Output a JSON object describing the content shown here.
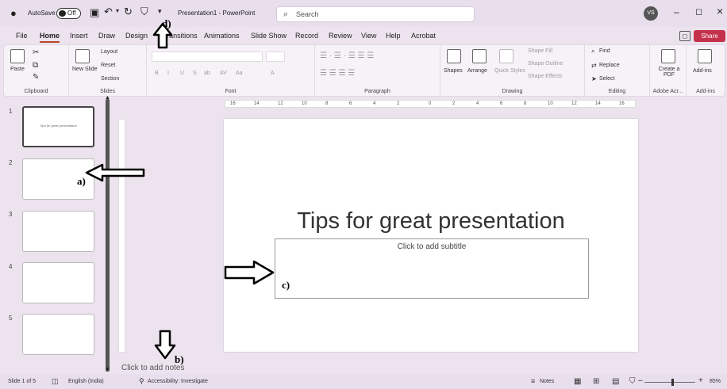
{
  "titlebar": {
    "autosave_label": "AutoSave",
    "autosave_state": "Off",
    "doc_title": "Presentation1 - PowerPoint",
    "search_placeholder": "Search",
    "avatar_initials": "VS",
    "minimize_glyph": "–",
    "restore_glyph": "◻",
    "close_glyph": "×"
  },
  "tabs": [
    "File",
    "Home",
    "Insert",
    "Draw",
    "Design",
    "Transitions",
    "Animations",
    "Slide Show",
    "Record",
    "Review",
    "View",
    "Help",
    "Acrobat"
  ],
  "active_tab": "Home",
  "share_label": "Share",
  "ribbon": {
    "clipboard": {
      "label": "Clipboard",
      "paste": "Paste"
    },
    "slides": {
      "label": "Slides",
      "new_slide": "New Slide",
      "layout": "Layout",
      "reset": "Reset",
      "section": "Section"
    },
    "font": {
      "label": "Font",
      "buttons": [
        "B",
        "I",
        "U",
        "S",
        "ab",
        "AV",
        "Aa",
        "A"
      ]
    },
    "paragraph": {
      "label": "Paragraph"
    },
    "drawing": {
      "label": "Drawing",
      "shapes": "Shapes",
      "arrange": "Arrange",
      "quick_styles": "Quick Styles",
      "shape_fill": "Shape Fill",
      "shape_outline": "Shape Outline",
      "shape_effects": "Shape Effects"
    },
    "editing": {
      "label": "Editing",
      "find": "Find",
      "replace": "Replace",
      "select": "Select"
    },
    "adobe": {
      "label": "Adobe Acr...",
      "create_pdf": "Create a PDF"
    },
    "addins": {
      "label": "Add-ins",
      "button": "Add-ins"
    }
  },
  "ruler_ticks": [
    "16",
    "14",
    "12",
    "10",
    "8",
    "6",
    "4",
    "2",
    "0",
    "2",
    "4",
    "6",
    "8",
    "10",
    "12",
    "14",
    "16"
  ],
  "thumbnails": [
    {
      "num": "1",
      "text": "Tips for great presentation"
    },
    {
      "num": "2",
      "text": ""
    },
    {
      "num": "3",
      "text": ""
    },
    {
      "num": "4",
      "text": ""
    },
    {
      "num": "5",
      "text": ""
    }
  ],
  "slide": {
    "title": "Tips for great presentation",
    "subtitle_placeholder": "Click to add subtitle"
  },
  "notes_placeholder": "Click to add notes",
  "annotations": {
    "a": "a)",
    "b": "b)",
    "c": "c)",
    "d": "d)"
  },
  "status": {
    "slide_info": "Slide 1 of 5",
    "language": "English (India)",
    "accessibility": "Accessibility: Investigate",
    "notes": "Notes",
    "zoom": "85%",
    "zoom_minus": "–",
    "zoom_plus": "+"
  }
}
